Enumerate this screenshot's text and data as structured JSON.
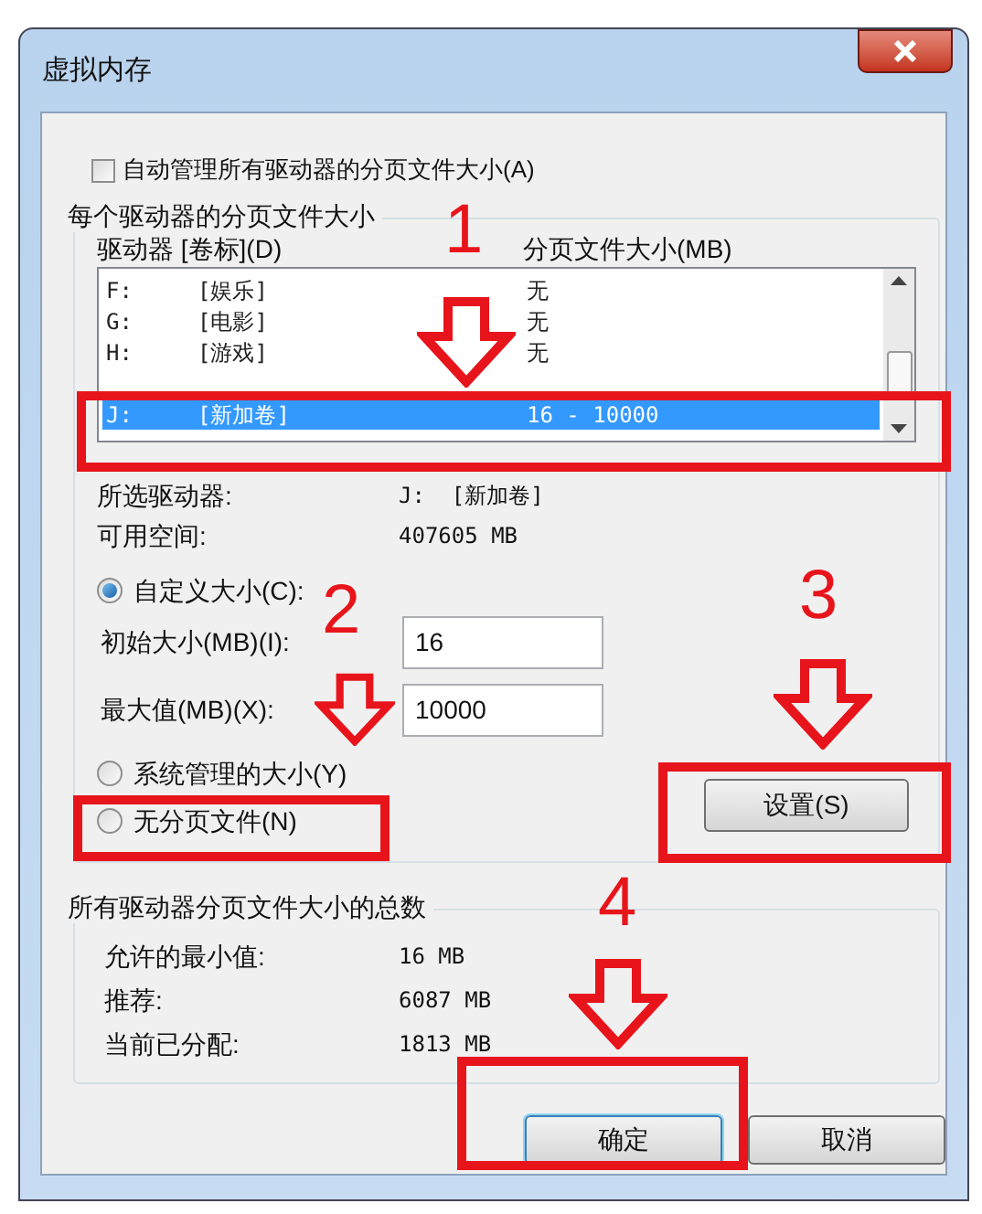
{
  "window": {
    "title": "虚拟内存"
  },
  "auto_manage": {
    "label": "自动管理所有驱动器的分页文件大小(A)",
    "checked": false
  },
  "per_drive": {
    "title": "每个驱动器的分页文件大小",
    "columns": [
      "驱动器 [卷标](D)",
      "分页文件大小(MB)"
    ],
    "drives": [
      {
        "letter": "F:",
        "label": "[娱乐]",
        "size": "无",
        "selected": false
      },
      {
        "letter": "G:",
        "label": "[电影]",
        "size": "无",
        "selected": false
      },
      {
        "letter": "H:",
        "label": "[游戏]",
        "size": "无",
        "selected": false
      },
      {
        "letter": "J:",
        "label": "[新加卷]",
        "size": "16 - 10000",
        "selected": true
      }
    ],
    "selected_drive": {
      "label": "所选驱动器:",
      "value": "J:  [新加卷]"
    },
    "free_space": {
      "label": "可用空间:",
      "value": "407605 MB"
    },
    "size_options": [
      {
        "label": "自定义大小(C):",
        "selected": true
      },
      {
        "label": "系统管理的大小(Y)",
        "selected": false
      },
      {
        "label": "无分页文件(N)",
        "selected": false
      }
    ],
    "initial_size": {
      "label": "初始大小(MB)(I):",
      "value": "16"
    },
    "maximum_size": {
      "label": "最大值(MB)(X):",
      "value": "10000"
    },
    "set_button": "设置(S)"
  },
  "totals": {
    "title": "所有驱动器分页文件大小的总数",
    "rows": [
      {
        "label": "允许的最小值:",
        "value": "16 MB"
      },
      {
        "label": "推荐:",
        "value": "6087 MB"
      },
      {
        "label": "当前已分配:",
        "value": "1813 MB"
      }
    ]
  },
  "buttons": [
    {
      "label": "确定",
      "default": true
    },
    {
      "label": "取消",
      "default": false
    }
  ],
  "annotations": [
    {
      "number": "1"
    },
    {
      "number": "2"
    },
    {
      "number": "3"
    },
    {
      "number": "4"
    }
  ]
}
